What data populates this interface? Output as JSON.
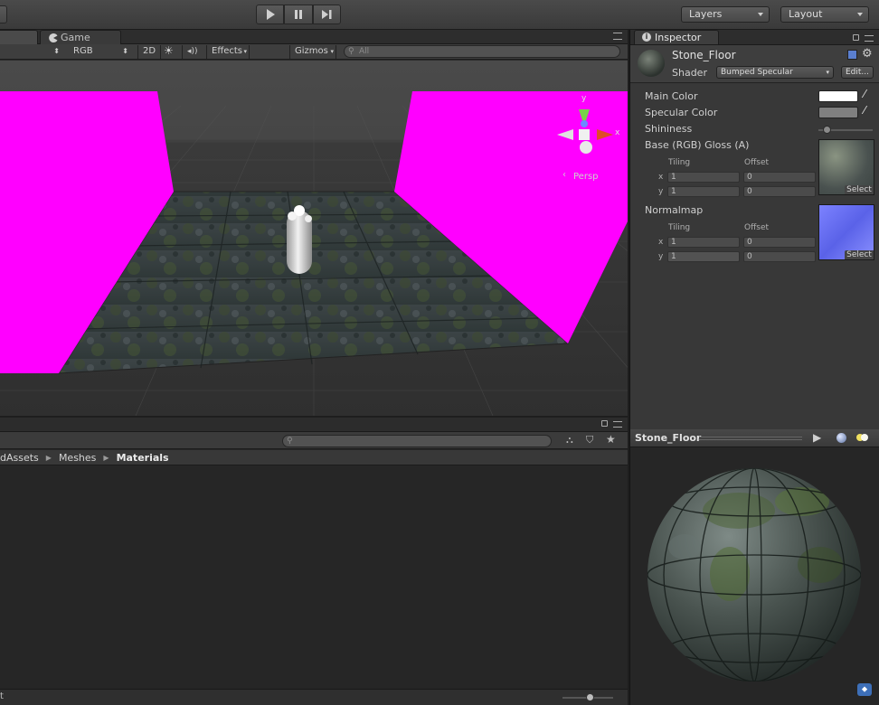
{
  "toolbar": {
    "play_icon": "play-icon",
    "pause_icon": "pause-icon",
    "step_icon": "step-icon",
    "layers_label": "Layers",
    "layout_label": "Layout"
  },
  "scene": {
    "tabs": [
      {
        "label": "Game"
      }
    ],
    "controls": {
      "render_mode": "RGB",
      "mode_2d": "2D",
      "effects": "Effects",
      "gizmos": "Gizmos",
      "search_placeholder": "All"
    },
    "gizmo": {
      "y_label": "y",
      "x_label": "x",
      "persp_label": "Persp"
    }
  },
  "project": {
    "breadcrumb": [
      "dAssets",
      "Meshes",
      "Materials"
    ],
    "footer_text": "t"
  },
  "inspector": {
    "tab_label": "Inspector",
    "material_name": "Stone_Floor",
    "shader_label": "Shader",
    "shader_value": "Bumped Specular",
    "edit_label": "Edit...",
    "properties": {
      "main_color": {
        "label": "Main Color",
        "color": "#ffffff"
      },
      "specular_color": {
        "label": "Specular Color",
        "color": "#808080"
      },
      "shininess": {
        "label": "Shininess",
        "value": 0.078
      },
      "base": {
        "label": "Base (RGB) Gloss (A)",
        "tiling_label": "Tiling",
        "offset_label": "Offset",
        "x_label": "x",
        "y_label": "y",
        "tiling_x": "1",
        "tiling_y": "1",
        "offset_x": "0",
        "offset_y": "0",
        "select_label": "Select"
      },
      "normalmap": {
        "label": "Normalmap",
        "tiling_label": "Tiling",
        "offset_label": "Offset",
        "x_label": "x",
        "y_label": "y",
        "tiling_x": "1",
        "tiling_y": "1",
        "offset_x": "0",
        "offset_y": "0",
        "select_label": "Select"
      }
    }
  },
  "preview": {
    "title": "Stone_Floor"
  },
  "colors": {
    "magenta": "#ff00ff",
    "panel_bg": "#383838",
    "accent_blue": "#3d6fb8"
  }
}
